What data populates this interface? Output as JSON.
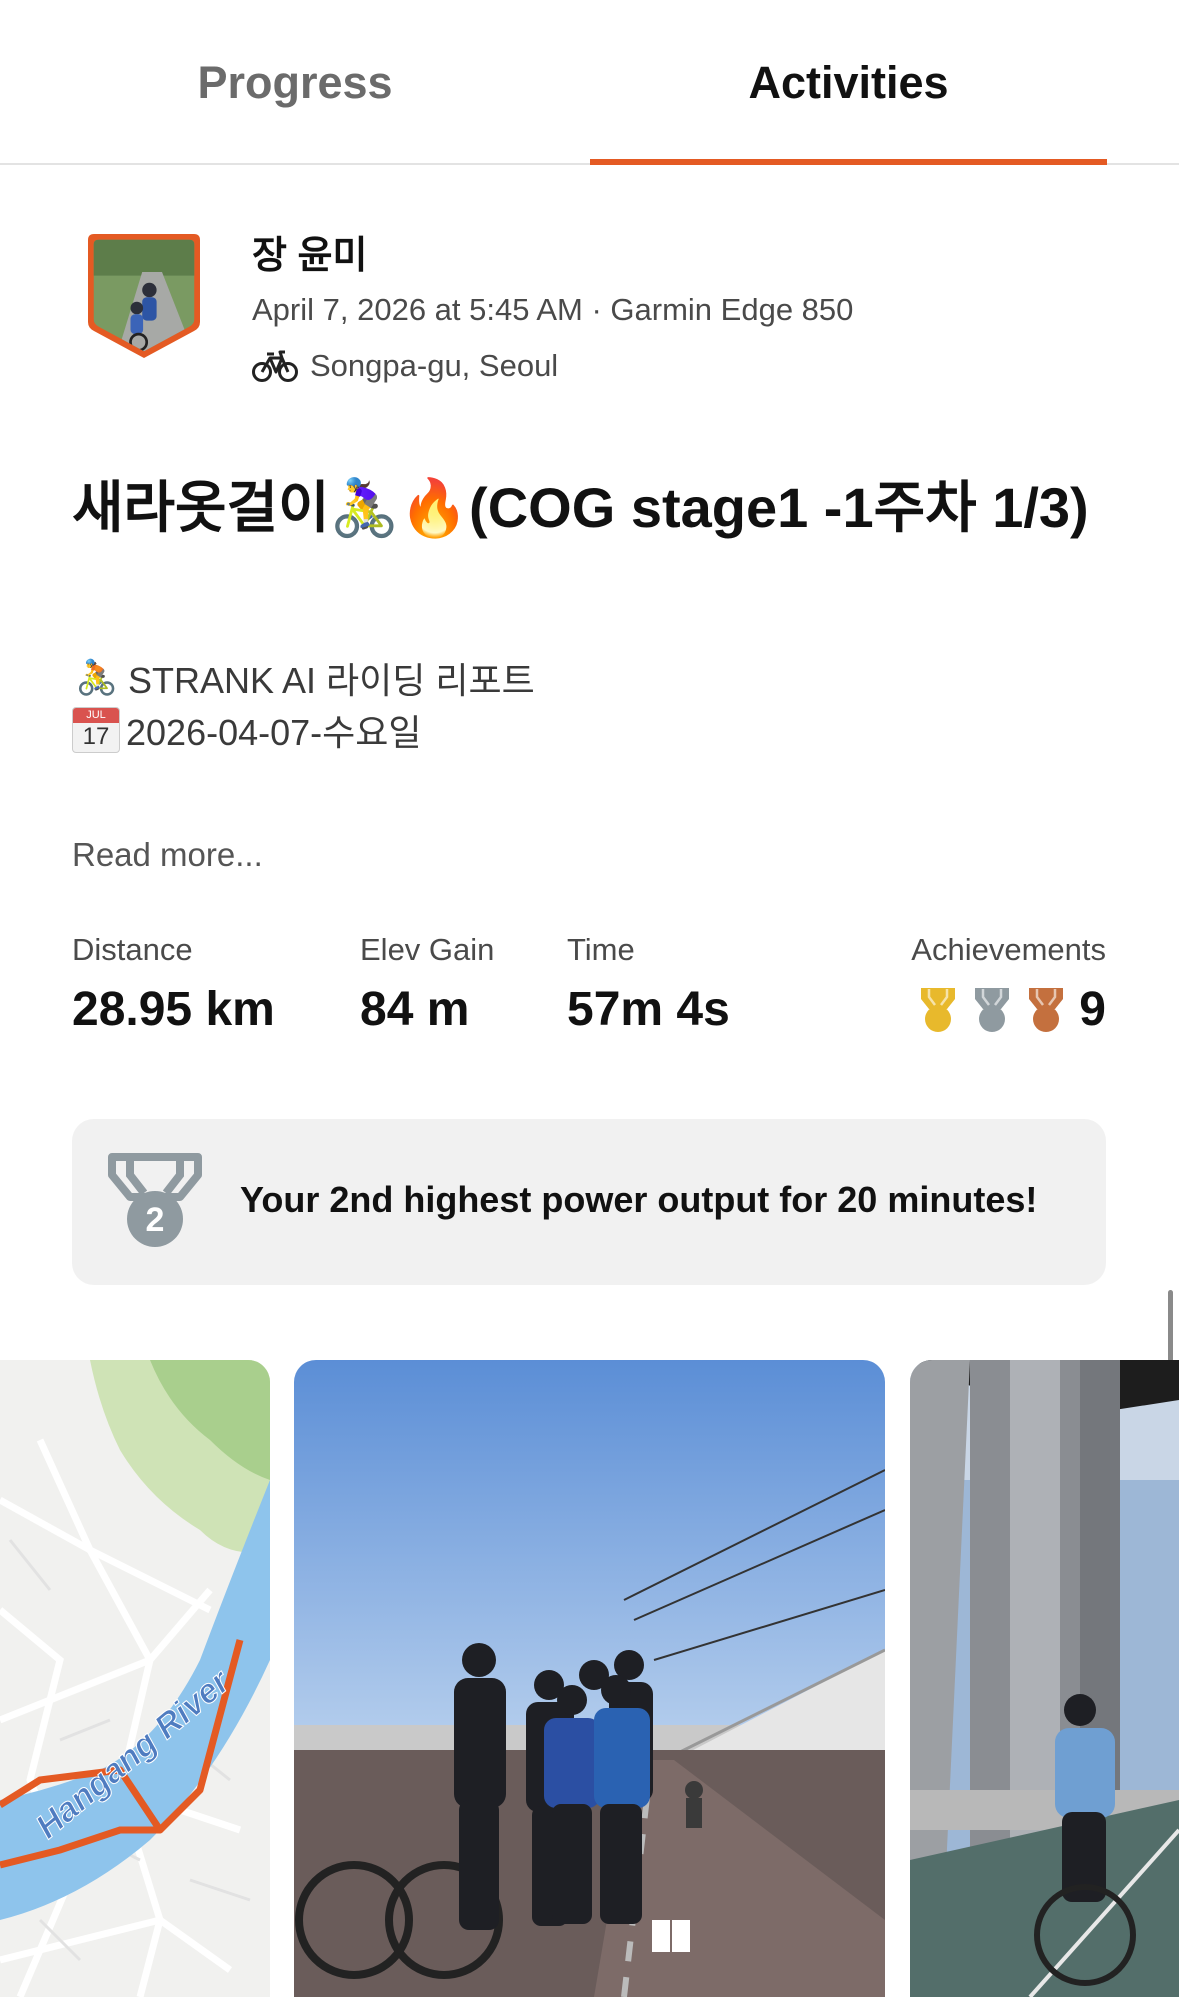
{
  "tabs": {
    "progress": "Progress",
    "activities": "Activities"
  },
  "header": {
    "athlete_name": "장 윤미",
    "datetime_device": "April 7, 2026 at 5:45 AM · Garmin Edge 850",
    "location": "Songpa-gu, Seoul",
    "activity_icon": "bike-icon"
  },
  "title": "새라옷걸이🚴‍♀️🔥(COG stage1 -1주차 1/3)",
  "description": {
    "line1_emoji": "🚴",
    "line1": "STRANK AI 라이딩 리포트",
    "line2_calendar_month": "JUL",
    "line2_calendar_day": "17",
    "line2": "2026-04-07-수요일"
  },
  "read_more": "Read more...",
  "stats": {
    "distance_label": "Distance",
    "distance_value": "28.95 km",
    "elev_label": "Elev Gain",
    "elev_value": "84 m",
    "time_label": "Time",
    "time_value": "57m 4s",
    "achievements_label": "Achievements",
    "achievements_count": "9"
  },
  "banner": {
    "medal_rank": "2",
    "text": "Your 2nd highest power output for 20 minutes!"
  },
  "map": {
    "river_label": "Hangang River"
  },
  "colors": {
    "accent": "#e45a23",
    "gold": "#e8b92c",
    "silver": "#8f9aa0",
    "bronze": "#c4703e",
    "banner_bg": "#f1f1f1"
  }
}
